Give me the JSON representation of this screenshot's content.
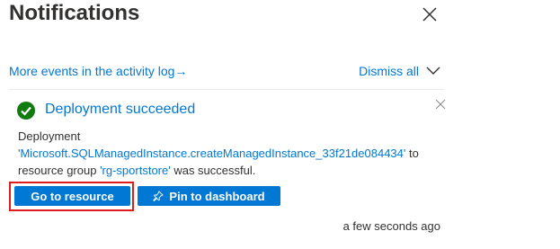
{
  "panel": {
    "title": "Notifications",
    "more_events_link": "More events in the activity log",
    "more_events_arrow": "→",
    "dismiss_all_label": "Dismiss all"
  },
  "notification": {
    "title": "Deployment succeeded",
    "body_prefix": "Deployment",
    "deployment_name": "'Microsoft.SQLManagedInstance.createManagedInstance_33f21de084434'",
    "body_middle": " to resource group ",
    "resource_group": "'rg-sportstore'",
    "body_suffix": " was successful.",
    "go_to_resource_label": "Go to resource",
    "pin_to_dashboard_label": "Pin to dashboard",
    "timestamp": "a few seconds ago",
    "status": "success"
  },
  "colors": {
    "accent": "#0078d4",
    "success": "#107c10",
    "highlight": "#e01d1d"
  },
  "icons": {
    "close": "close-icon",
    "dismiss_chevron": "chevron-down-icon",
    "status": "success-check-icon",
    "pin": "pin-icon"
  }
}
